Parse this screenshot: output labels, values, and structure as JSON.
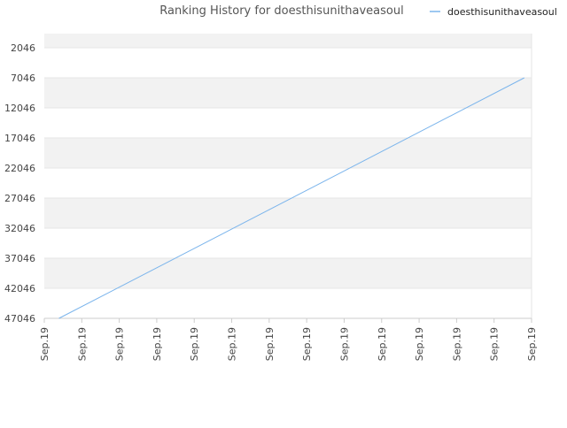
{
  "chart_data": {
    "type": "line",
    "title": "Ranking History for doesthisunithaveasoul",
    "xlabel": "",
    "ylabel": "",
    "y_inverted": true,
    "ylim": [
      2046,
      47046
    ],
    "y_ticks": [
      2046,
      7046,
      12046,
      17046,
      22046,
      27046,
      32046,
      37046,
      42046,
      47046
    ],
    "x_tick_labels": [
      "Sep.19",
      "Sep.19",
      "Sep.19",
      "Sep.19",
      "Sep.19",
      "Sep.19",
      "Sep.19",
      "Sep.19",
      "Sep.19",
      "Sep.19",
      "Sep.19",
      "Sep.19",
      "Sep.19",
      "Sep.19"
    ],
    "grid": "horizontal alternating bands",
    "legend_position": "top-right",
    "series": [
      {
        "name": "doesthisunithaveasoul",
        "color": "#7cb5ec",
        "points": [
          {
            "x": 0.03,
            "y": 47046
          },
          {
            "x": 0.985,
            "y": 7046
          }
        ]
      }
    ],
    "colors": {
      "band_alt": "#f2f2f2",
      "band": "#ffffff",
      "grid_line": "#e6e6e6",
      "axis_text": "#444444",
      "title_text": "#555555"
    }
  }
}
